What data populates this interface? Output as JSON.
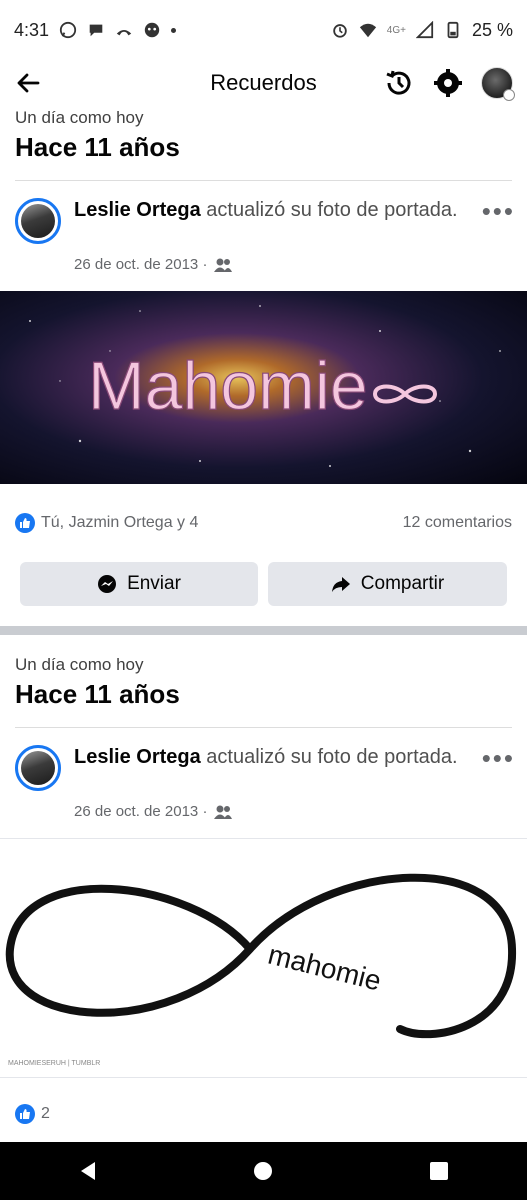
{
  "status": {
    "time": "4:31",
    "network": "4G+",
    "battery": "25 %"
  },
  "header": {
    "title": "Recuerdos"
  },
  "memories": [
    {
      "subtitle": "Un día como hoy",
      "title": "Hace 11 años",
      "author": "Leslie Ortega",
      "action": "actualizó su foto de portada.",
      "date": "26 de oct. de 2013 ·",
      "cover_text": "Mahomie",
      "reactions": "Tú, Jazmin Ortega y 4",
      "comments": "12 comentarios",
      "send_label": "Enviar",
      "share_label": "Compartir"
    },
    {
      "subtitle": "Un día como hoy",
      "title": "Hace 11 años",
      "author": "Leslie Ortega",
      "action": "actualizó su foto de portada.",
      "date": "26 de oct. de 2013 ·",
      "cover_text": "mahomie",
      "watermark": "MAHOMIESERUH | TUMBLR",
      "reactions": "2"
    }
  ],
  "colors": {
    "accent": "#1877f2",
    "button_bg": "#e4e6eb",
    "muted": "#65676b"
  },
  "icons": [
    "back-arrow-icon",
    "history-icon",
    "gear-icon",
    "messenger-icon",
    "share-arrow-icon",
    "friends-icon",
    "like-icon",
    "more-icon"
  ]
}
